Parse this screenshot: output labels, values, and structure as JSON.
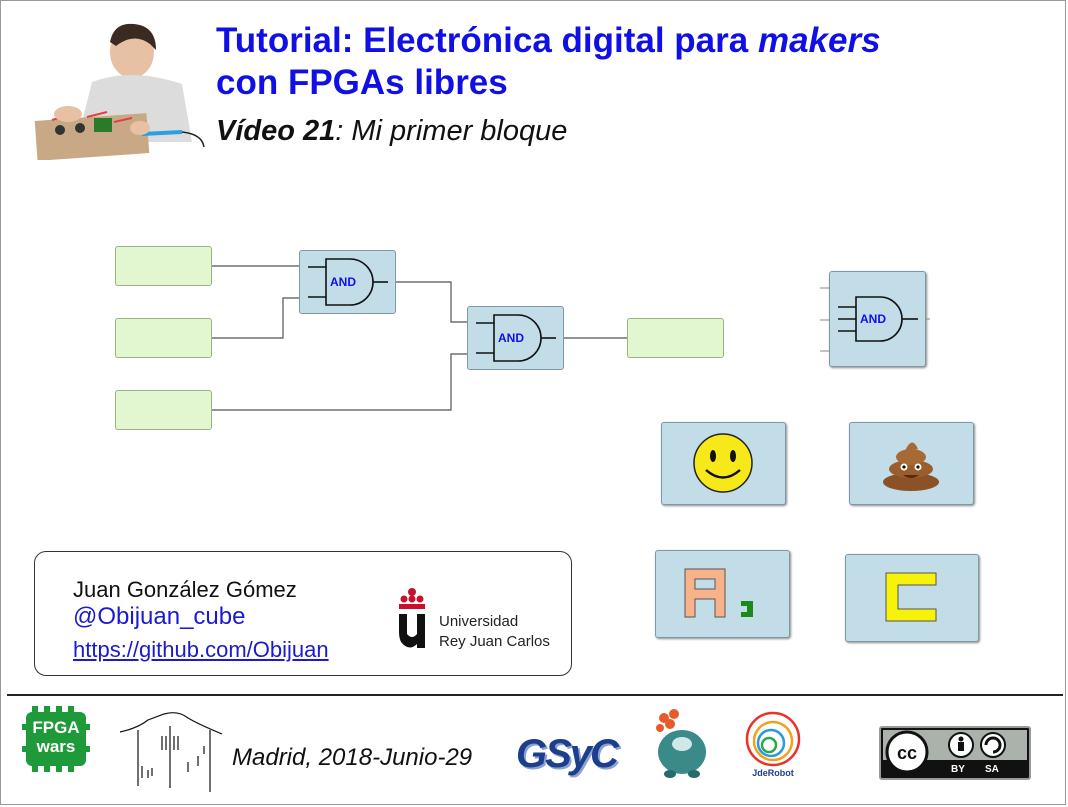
{
  "header": {
    "title_part1": "Tutorial: Electrónica digital para ",
    "title_em": "makers",
    "title_line2": "con FPGAs libres",
    "subtitle_bold": "Vídeo 21",
    "subtitle_rest": ": Mi primer bloque"
  },
  "diagram": {
    "gate1_label": "AND",
    "gate2_label": "AND",
    "block_label": "AND"
  },
  "author": {
    "name": "Juan González Gómez",
    "handle": "@Obijuan_cube",
    "link": "https://github.com/Obijuan"
  },
  "university": {
    "line1": "Universidad",
    "line2": "Rey Juan Carlos"
  },
  "footer": {
    "date": "Madrid, 2018-Junio-29",
    "fpga_logo_line1": "FPGA",
    "fpga_logo_line2": "wars",
    "gsyc_logo": "GSyC",
    "jderobot_logo": "JdeRobot",
    "cc_by": "BY",
    "cc_sa": "SA"
  },
  "colors": {
    "title": "#1010e6",
    "input_fill": "#e2f7cf",
    "gate_fill": "#c2dce8",
    "and_text": "#1010e6"
  }
}
